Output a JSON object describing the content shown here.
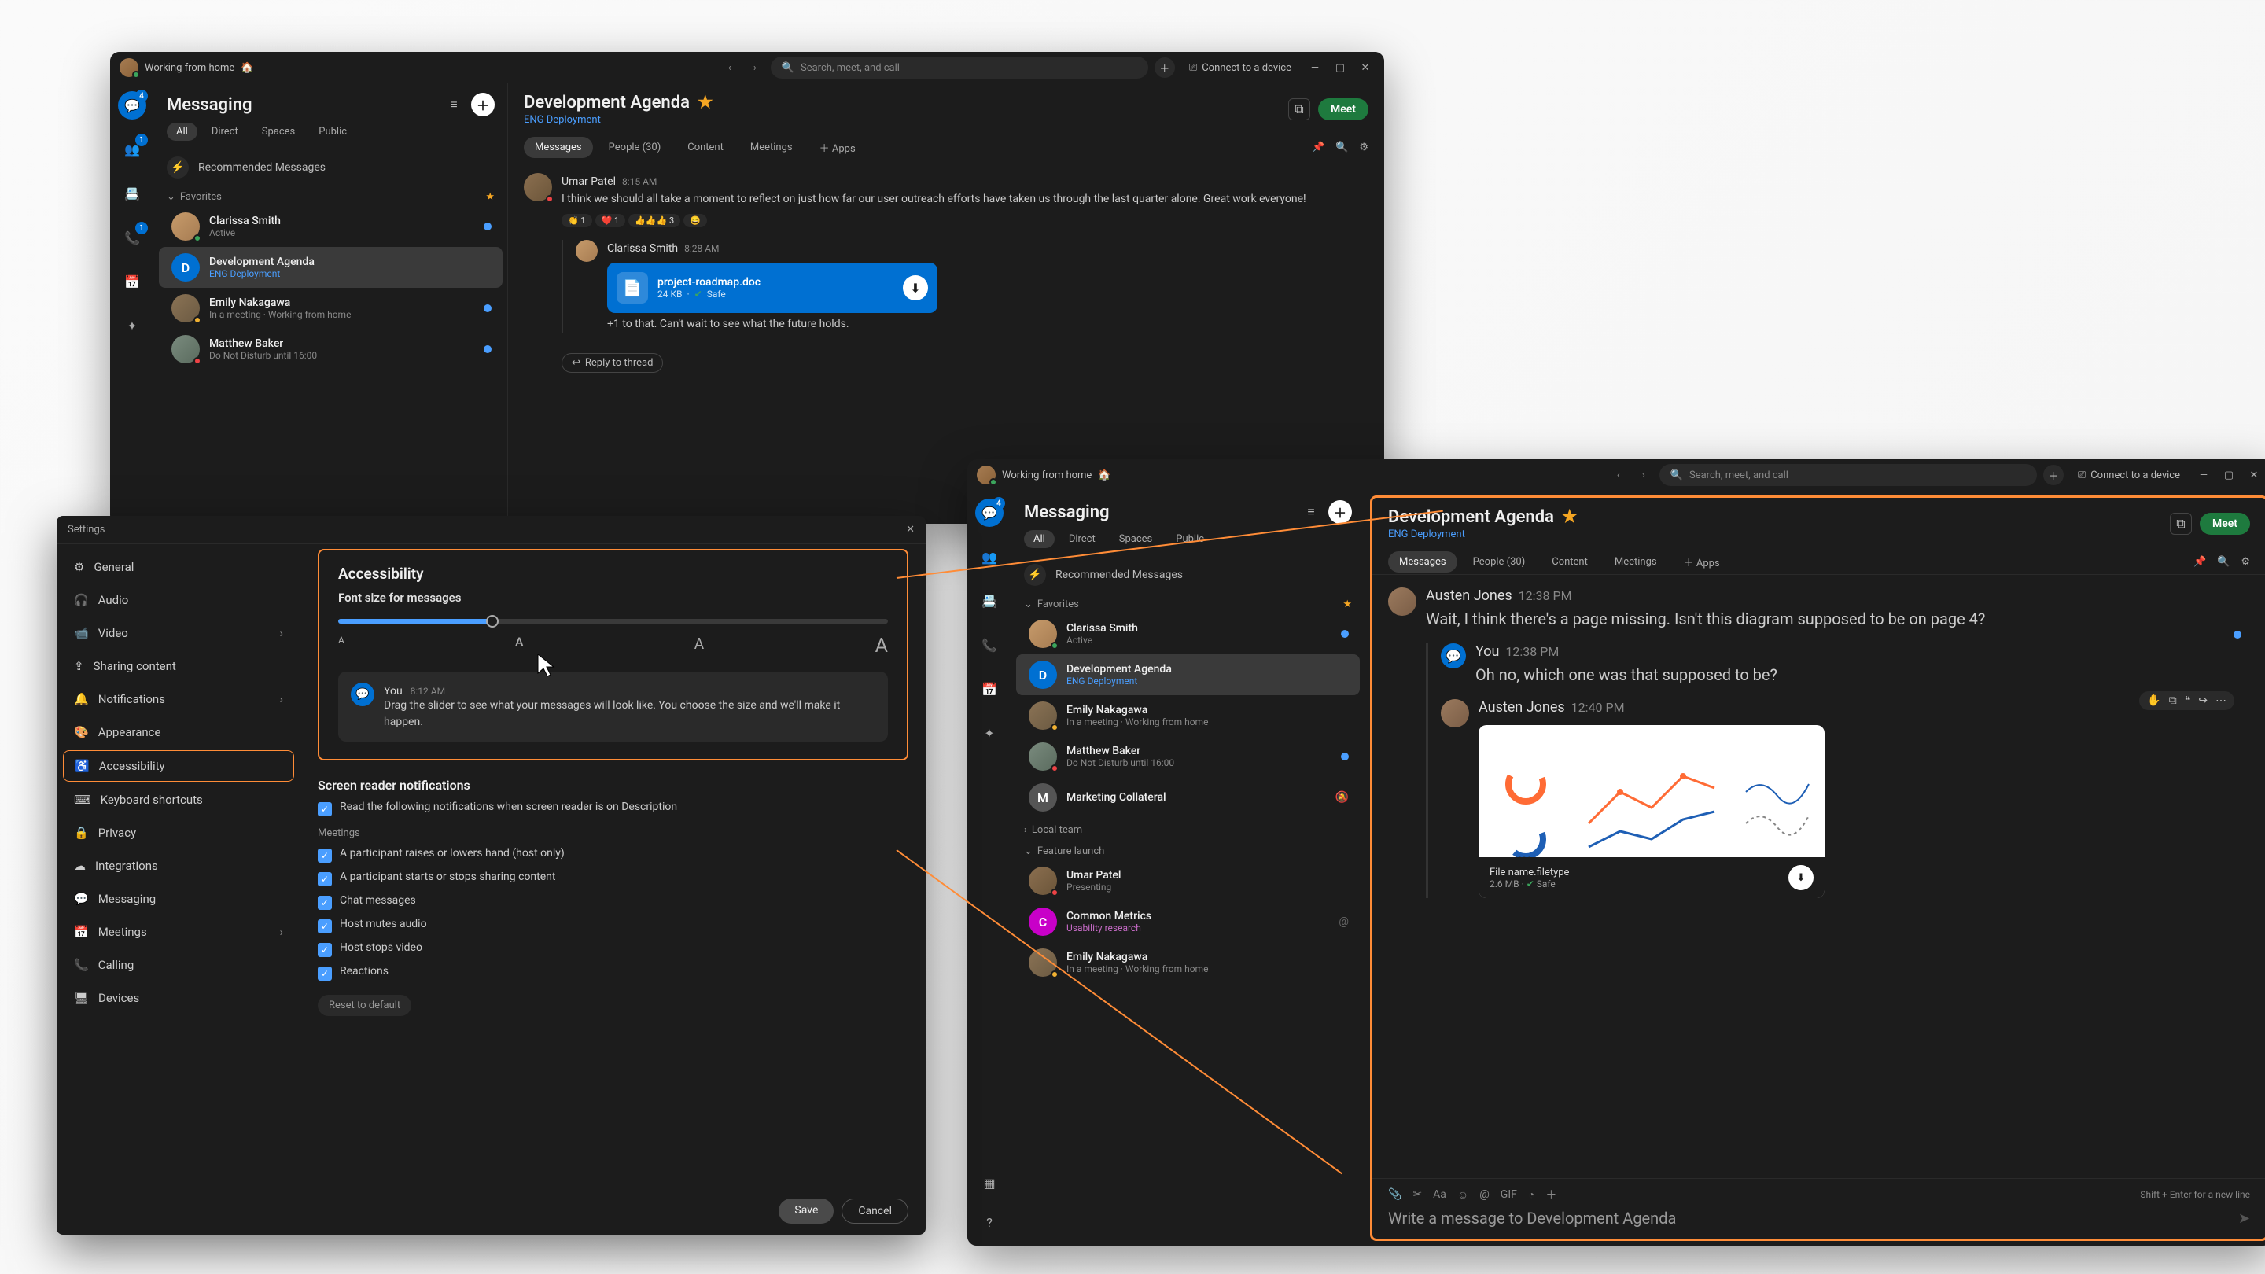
{
  "status_bar": {
    "text": "Working from home",
    "emoji": "🏠"
  },
  "search_placeholder": "Search, meet, and call",
  "connect_device": "Connect to a device",
  "rail_badges": {
    "chat": "4",
    "teams": "1",
    "calls": "1"
  },
  "messaging_title": "Messaging",
  "filters": [
    "All",
    "Direct",
    "Spaces",
    "Public"
  ],
  "recommended": "Recommended Messages",
  "fav_section": "Favorites",
  "local_team_section": "Local team",
  "feature_launch_section": "Feature launch",
  "convos": {
    "clarissa": {
      "name": "Clarissa Smith",
      "sub": "Active"
    },
    "dev_agenda": {
      "name": "Development Agenda",
      "sub": "ENG Deployment"
    },
    "emily": {
      "name": "Emily Nakagawa",
      "sub": "In a meeting  ·  Working from home"
    },
    "matthew": {
      "name": "Matthew Baker",
      "sub": "Do Not Disturb until 16:00"
    },
    "marketing": {
      "name": "Marketing Collateral"
    },
    "umar2": {
      "name": "Umar Patel",
      "sub": "Presenting"
    },
    "common": {
      "name": "Common Metrics",
      "sub": "Usability research"
    },
    "emily2": {
      "name": "Emily Nakagawa",
      "sub": "In a meeting  ·  Working from home"
    }
  },
  "chat_title": "Development Agenda",
  "chat_sub": "ENG Deployment",
  "meet": "Meet",
  "tabs": {
    "messages": "Messages",
    "people": "People (30)",
    "content": "Content",
    "meetings": "Meetings",
    "apps": "Apps"
  },
  "back_msgs": {
    "umar": {
      "name": "Umar Patel",
      "time": "8:15 AM",
      "text": "I think we should all take a moment to reflect on just how far our user outreach efforts have taken us through the last quarter alone. Great work everyone!"
    },
    "reacts": [
      "👏 1",
      "❤️ 1",
      "👍👍👍 3",
      "😄"
    ],
    "clarissa": {
      "name": "Clarissa Smith",
      "time": "8:28 AM",
      "text": "+1 to that. Can't wait to see what the future holds."
    },
    "file": {
      "name": "project-roadmap.doc",
      "size": "24 KB",
      "safe": "Safe"
    },
    "reply": "Reply to thread"
  },
  "front_msgs": {
    "austen1": {
      "name": "Austen Jones",
      "time": "12:38 PM",
      "text": "Wait, I think there's a page missing. Isn't this diagram supposed to be on page 4?"
    },
    "you": {
      "name": "You",
      "time": "12:38 PM",
      "text": "Oh no, which one was that supposed to be?"
    },
    "austen2": {
      "name": "Austen Jones",
      "time": "12:40 PM"
    },
    "attachment": {
      "name": "File name.filetype",
      "size": "2.6 MB",
      "safe": "Safe"
    }
  },
  "composer": {
    "placeholder": "Write a message to Development Agenda",
    "hint": "Shift + Enter for a new line"
  },
  "settings": {
    "title": "Settings",
    "nav": [
      "General",
      "Audio",
      "Video",
      "Sharing content",
      "Notifications",
      "Appearance",
      "Accessibility",
      "Keyboard shortcuts",
      "Privacy",
      "Integrations",
      "Messaging",
      "Meetings",
      "Calling",
      "Devices"
    ],
    "acc": {
      "heading": "Accessibility",
      "font_label": "Font size for messages",
      "preview": {
        "name": "You",
        "time": "8:12 AM",
        "text": "Drag the slider to see what your messages will look like. You choose the size and we'll make it happen."
      },
      "sr_heading": "Screen reader notifications",
      "sr_desc": "Read the following notifications when screen reader is on Description",
      "sr_meetings": "Meetings",
      "opts": [
        "A participant raises or lowers hand (host only)",
        "A participant starts or stops sharing content",
        "Chat messages",
        "Host mutes audio",
        "Host stops video",
        "Reactions"
      ],
      "reset": "Reset to default"
    },
    "save": "Save",
    "cancel": "Cancel"
  }
}
